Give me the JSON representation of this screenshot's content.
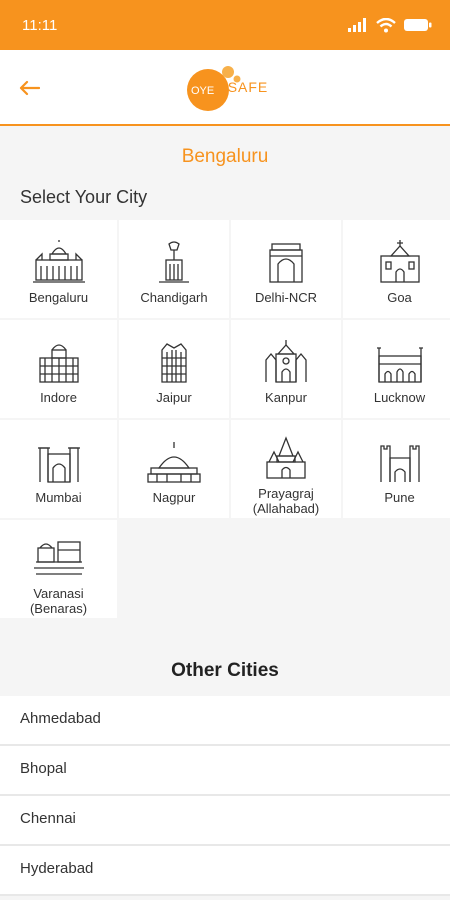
{
  "status_bar": {
    "time": "11:11"
  },
  "header": {
    "logo_left": "OYE",
    "logo_right": "SAFE"
  },
  "selected_city": "Bengaluru",
  "section_title": "Select Your City",
  "cities": [
    {
      "name": "Bengaluru",
      "icon": "vidhana-soudha-icon"
    },
    {
      "name": "Chandigarh",
      "icon": "open-hand-monument-icon"
    },
    {
      "name": "Delhi-NCR",
      "icon": "india-gate-icon"
    },
    {
      "name": "Goa",
      "icon": "church-icon"
    },
    {
      "name": "Indore",
      "icon": "rajwada-palace-icon"
    },
    {
      "name": "Jaipur",
      "icon": "hawa-mahal-icon"
    },
    {
      "name": "Kanpur",
      "icon": "cathedral-icon"
    },
    {
      "name": "Lucknow",
      "icon": "imambara-icon"
    },
    {
      "name": "Mumbai",
      "icon": "gateway-of-india-icon"
    },
    {
      "name": "Nagpur",
      "icon": "deekshabhoomi-stupa-icon"
    },
    {
      "name": "Prayagraj\n(Allahabad)",
      "icon": "temple-icon"
    },
    {
      "name": "Pune",
      "icon": "fort-icon"
    },
    {
      "name": "Varanasi\n(Benaras)",
      "icon": "ghats-icon"
    }
  ],
  "other_cities_title": "Other Cities",
  "other_cities": [
    "Ahmedabad",
    "Bhopal",
    "Chennai",
    "Hyderabad"
  ]
}
